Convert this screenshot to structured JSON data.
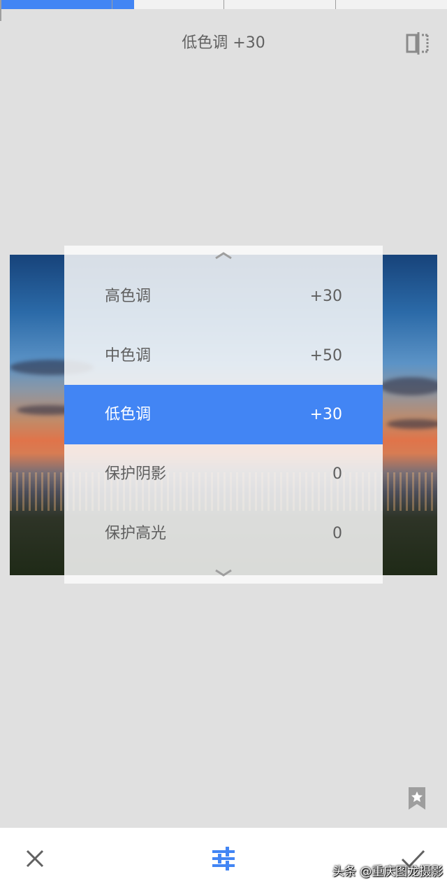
{
  "header": {
    "title": "低色调 +30",
    "compare_icon": "compare-split-icon"
  },
  "top_slider": {
    "progress_fraction": 0.3
  },
  "adjust_menu": {
    "selected_index": 2,
    "items": [
      {
        "label": "高色调",
        "value": "+30"
      },
      {
        "label": "中色调",
        "value": "+50"
      },
      {
        "label": "低色调",
        "value": "+30"
      },
      {
        "label": "保护阴影",
        "value": "0"
      },
      {
        "label": "保护高光",
        "value": "0"
      }
    ],
    "scroll_up_icon": "chevron-up-icon",
    "scroll_down_icon": "chevron-down-icon"
  },
  "bookmark_icon": "bookmark-star-icon",
  "bottom_bar": {
    "cancel_icon": "close-icon",
    "tune_icon": "tune-sliders-icon",
    "apply_icon": "check-icon"
  },
  "watermark": "头条 @重庆图龙摄影",
  "colors": {
    "accent": "#4285f4",
    "background": "#e0e0e0",
    "text": "#616161"
  }
}
